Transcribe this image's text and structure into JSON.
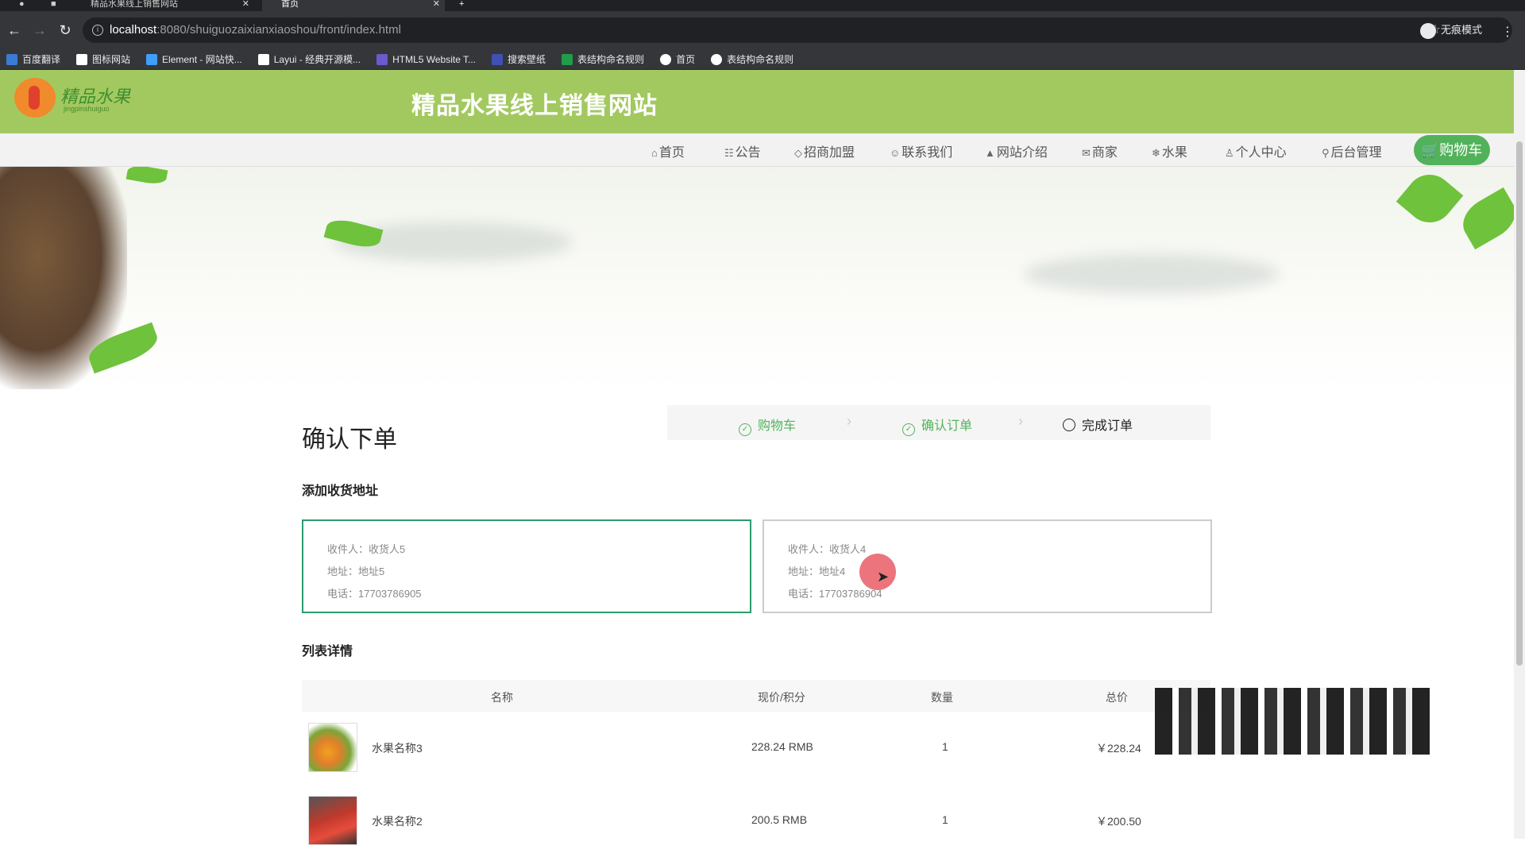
{
  "browser": {
    "tabs": [
      {
        "label": "精品水果线上销售网站"
      },
      {
        "label": "首页"
      }
    ],
    "new_tab": "+",
    "url_host": "localhost",
    "url_path": ":8080/shuiguozaixianxiaoshou/front/index.html",
    "incognito_label": "无痕模式",
    "bookmarks": [
      {
        "label": "百度翻译",
        "color": "#3a7bd5"
      },
      {
        "label": "图标网站",
        "color": "#ffffff"
      },
      {
        "label": "Element - 网站快...",
        "color": "#409eff"
      },
      {
        "label": "Layui - 经典开源模...",
        "color": "#ffffff"
      },
      {
        "label": "HTML5 Website T...",
        "color": "#6a5acd"
      },
      {
        "label": "搜索壁纸",
        "color": "#3f51b5"
      },
      {
        "label": "表结构命名规则",
        "color": "#1e9e4a"
      },
      {
        "label": "首页",
        "color": "#ffffff"
      },
      {
        "label": "表结构命名规则",
        "color": "#ffffff"
      }
    ]
  },
  "site": {
    "logo_text": "精品水果",
    "logo_sub": "jingpinshuiguo",
    "title": "精品水果线上销售网站",
    "accent_color": "#a2c960",
    "nav": [
      {
        "icon": "home-icon",
        "glyph": "⌂",
        "label": "首页"
      },
      {
        "icon": "notice-icon",
        "glyph": "☷",
        "label": "公告"
      },
      {
        "icon": "tag-icon",
        "glyph": "◇",
        "label": "招商加盟"
      },
      {
        "icon": "contact-icon",
        "glyph": "☺",
        "label": "联系我们"
      },
      {
        "icon": "about-icon",
        "glyph": "▲",
        "label": "网站介绍"
      },
      {
        "icon": "mail-icon",
        "glyph": "✉",
        "label": "商家"
      },
      {
        "icon": "snowflake-icon",
        "glyph": "❄",
        "label": "水果"
      },
      {
        "icon": "user-icon",
        "glyph": "♙",
        "label": "个人中心"
      },
      {
        "icon": "link-icon",
        "glyph": "⚲",
        "label": "后台管理"
      }
    ],
    "cart_label": "购物车"
  },
  "order": {
    "page_title": "确认下单",
    "steps": [
      {
        "label": "购物车",
        "status": "done"
      },
      {
        "label": "确认订单",
        "status": "done"
      },
      {
        "label": "完成订单",
        "status": "current"
      }
    ],
    "address_section_title": "添加收货地址",
    "addresses": [
      {
        "receiver": "收件人：收货人5",
        "address": "地址：地址5",
        "phone": "电话：17703786905",
        "selected": true
      },
      {
        "receiver": "收件人：收货人4",
        "address": "地址：地址4",
        "phone": "电话：17703786904",
        "selected": false
      }
    ],
    "list_section_title": "列表详情",
    "columns": [
      "名称",
      "现价/积分",
      "数量",
      "总价"
    ],
    "items": [
      {
        "name": "水果名称3",
        "price": "228.24 RMB",
        "qty": "1",
        "total": "￥228.24"
      },
      {
        "name": "水果名称2",
        "price": "200.5 RMB",
        "qty": "1",
        "total": "￥200.50"
      }
    ]
  }
}
